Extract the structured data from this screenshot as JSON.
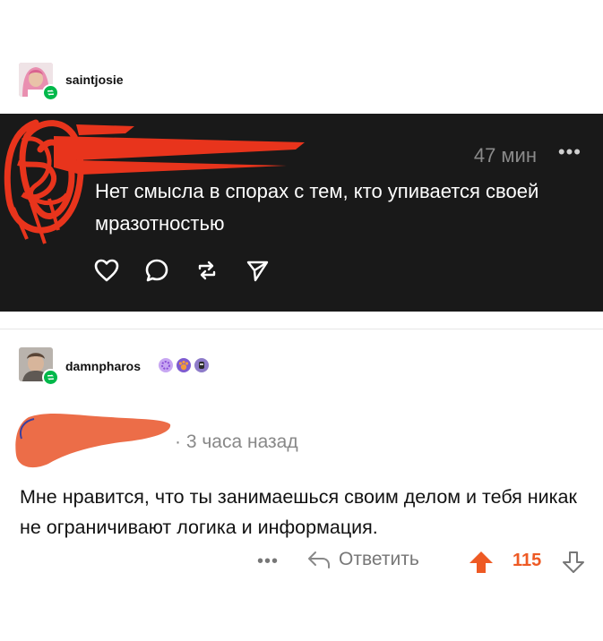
{
  "post1": {
    "username": "saintjosie"
  },
  "dark_comment": {
    "time": "47 мин",
    "more": "•••",
    "text": "Нет смысла в спорах с тем, кто упивается своей мразотностью"
  },
  "post2": {
    "username": "damnpharos"
  },
  "comment": {
    "time": "· 3 часа назад",
    "text": "Мне нравится, что ты занимаешься своим делом и тебя никак не ограничивают логика и информация.",
    "more": "•••",
    "reply_label": "Ответить",
    "score": "115"
  },
  "colors": {
    "dark_bg": "#191919",
    "reblog_green": "#00b84a",
    "upvote_orange": "#ee5a24",
    "redaction_red": "#e8341c"
  }
}
